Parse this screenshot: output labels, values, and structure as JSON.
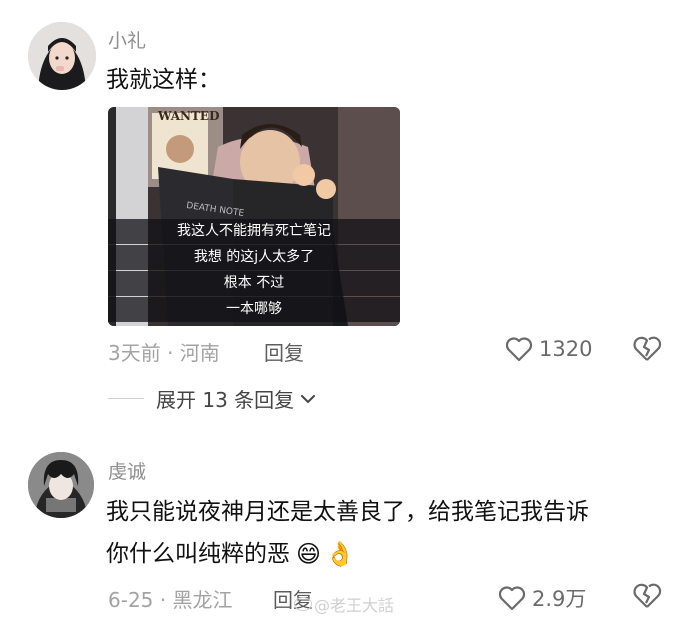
{
  "comments": [
    {
      "author": "小礼",
      "text": "我就这样：",
      "image_subtitles": [
        "我这人不能拥有死亡笔记",
        "我想 的这j人太多了",
        "根本 不过",
        "一本哪够"
      ],
      "meta": "3天前 · 河南",
      "reply_label": "回复",
      "likes": "1320",
      "expand_label": "展开 13 条回复"
    },
    {
      "author": "虔诚",
      "text_line1": "我只能说夜神月还是太善良了，给我笔记我告诉",
      "text_line2": "你什么叫纯粹的恶",
      "emoji1": "😄",
      "emoji2": "👌",
      "meta": "6-25 · 黑龙江",
      "reply_label": "回复",
      "likes": "2.9万"
    }
  ],
  "watermark": "@老王大話",
  "poster_text": "WANTED",
  "book_text": "DEATH NOTE",
  "colors": {
    "meta": "#a3a3a3",
    "text": "#111111",
    "name": "#8f8f8f"
  }
}
